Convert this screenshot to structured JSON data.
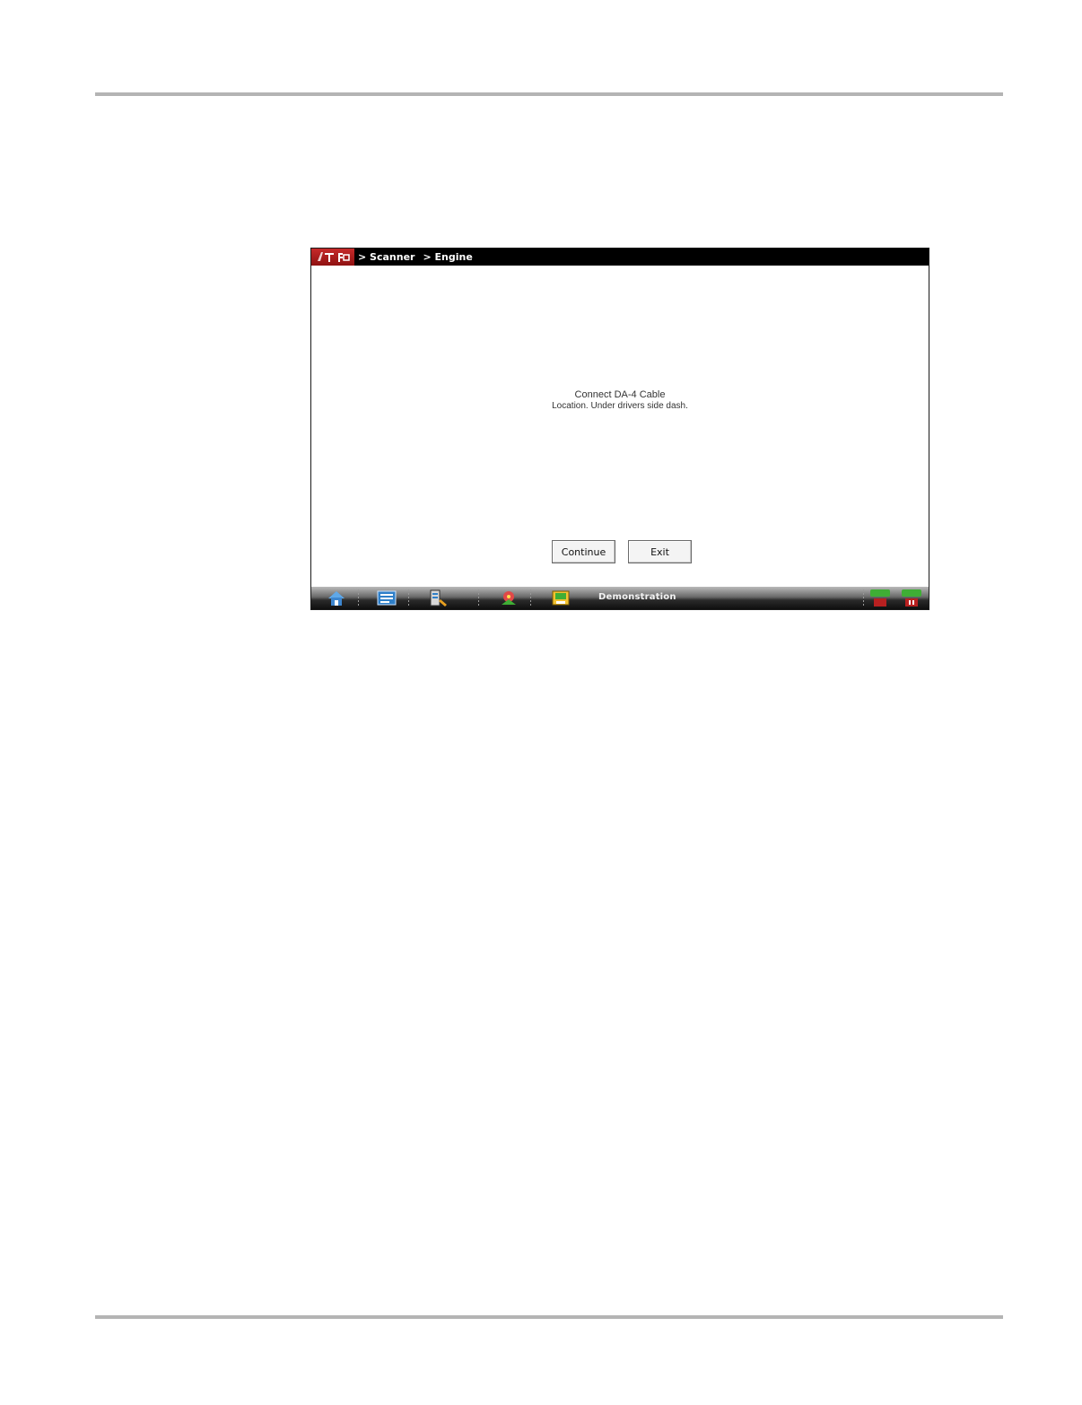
{
  "breadcrumb": [
    "> Scanner",
    "> Engine"
  ],
  "message": {
    "line1": "Connect DA-4 Cable",
    "line2": "Location. Under drivers side dash."
  },
  "buttons": {
    "continue_label": "Continue",
    "exit_label": "Exit"
  },
  "toolbar": {
    "icons": [
      "home-icon",
      "data-list-icon",
      "tools-icon",
      "vehicle-id-icon",
      "save-icon",
      "record-icon",
      "stop-icon"
    ],
    "status": "Demonstration"
  },
  "colors": {
    "titlebar": "#000000",
    "logo": "#c62a2a",
    "accent_green": "#3fae35"
  }
}
